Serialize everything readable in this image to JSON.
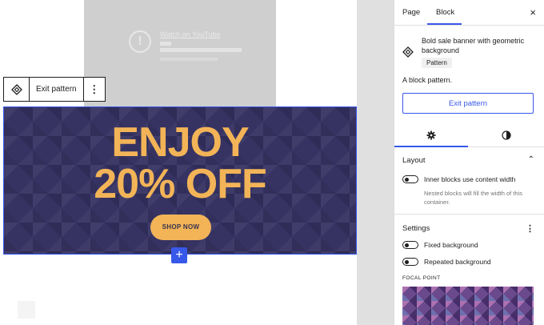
{
  "toolbar": {
    "exit_label": "Exit pattern",
    "more_icon": "more-vertical-icon",
    "pattern_icon": "pattern-icon"
  },
  "video": {
    "title_text": "Watch on YouTube",
    "warning_icon": "warning-icon"
  },
  "banner": {
    "line1": "ENJOY",
    "line2": "20% OFF",
    "button": "SHOP NOW",
    "text_color": "#f2b457",
    "bg_color": "#363363",
    "selection_color": "#3858e9"
  },
  "inserter": {
    "label": "+"
  },
  "sidebar": {
    "tabs": [
      {
        "label": "Page"
      },
      {
        "label": "Block"
      }
    ],
    "close_label": "×",
    "block": {
      "title": "Bold sale banner with geometric background",
      "badge": "Pattern",
      "description": "A block pattern.",
      "exit_button": "Exit pattern"
    },
    "subtabs": {
      "settings_icon": "gear-icon",
      "styles_icon": "contrast-icon"
    },
    "layout": {
      "heading": "Layout",
      "toggle_label": "Inner blocks use content width",
      "help": "Nested blocks will fill the width of this container."
    },
    "settings": {
      "heading": "Settings",
      "fixed_bg": "Fixed background",
      "repeated_bg": "Repeated background",
      "focal_label": "FOCAL POINT"
    }
  }
}
